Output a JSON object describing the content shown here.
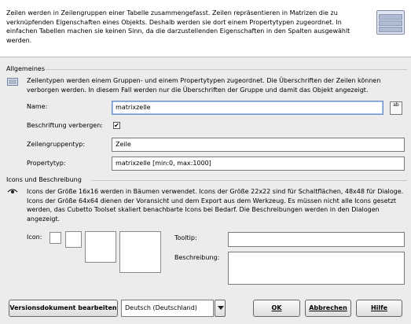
{
  "header": {
    "description": "Zeilen werden in Zeilengruppen einer Tabelle zusammengefasst. Zeilen repräsentieren in Matrizen die zu verknüpfenden Eigenschaften eines Objekts. Deshalb werden sie dort einem Propertytypen zugeordnet. In einfachen Tabellen machen sie keinen Sinn, da die darzustellenden Eigenschaften in den Spalten ausgewählt werden.",
    "icon": "table-rows-icon"
  },
  "allgemeines": {
    "title": "Allgemeines",
    "description": "Zeilentypen werden einem Gruppen- und einem Propertytypen zugeordnet. Die Überschriften der Zeilen können verborgen werden. In diesem Fall werden nur die Überschriften der Gruppe und damit das Objekt angezeigt.",
    "name_label": "Name:",
    "name_value": "matrixzelle",
    "name_button": "ab",
    "hide_label": "Beschriftung verbergen:",
    "hide_checked": "✔",
    "group_label": "Zeilengruppentyp:",
    "group_value": "Zeile",
    "prop_label": "Propertytyp:",
    "prop_value": "matrixzelle [min:0, max:1000]"
  },
  "icons": {
    "title": "Icons und Beschreibung",
    "description": "Icons der Größe 16x16 werden in Bäumen verwendet. Icons der Größe 22x22 sind für Schaltflächen, 48x48 für Dialoge. Icons der Größe 64x64 dienen der Voransicht und dem Export aus dem Werkzeug. Es müssen nicht alle Icons gesetzt werden, das Cubetto Toolset skaliert benachbarte Icons bei Bedarf. Die Beschreibungen werden in den Dialogen angezeigt.",
    "icon_label": "Icon:",
    "tooltip_label": "Tooltip:",
    "tooltip_value": "",
    "beschreibung_label": "Beschreibung:",
    "beschreibung_value": ""
  },
  "footer": {
    "version_button": "Versionsdokument bearbeiten",
    "language_value": "Deutsch (Deutschland)",
    "ok_button": "OK",
    "cancel_button": "Abbrechen",
    "help_button": "Hilfe"
  }
}
